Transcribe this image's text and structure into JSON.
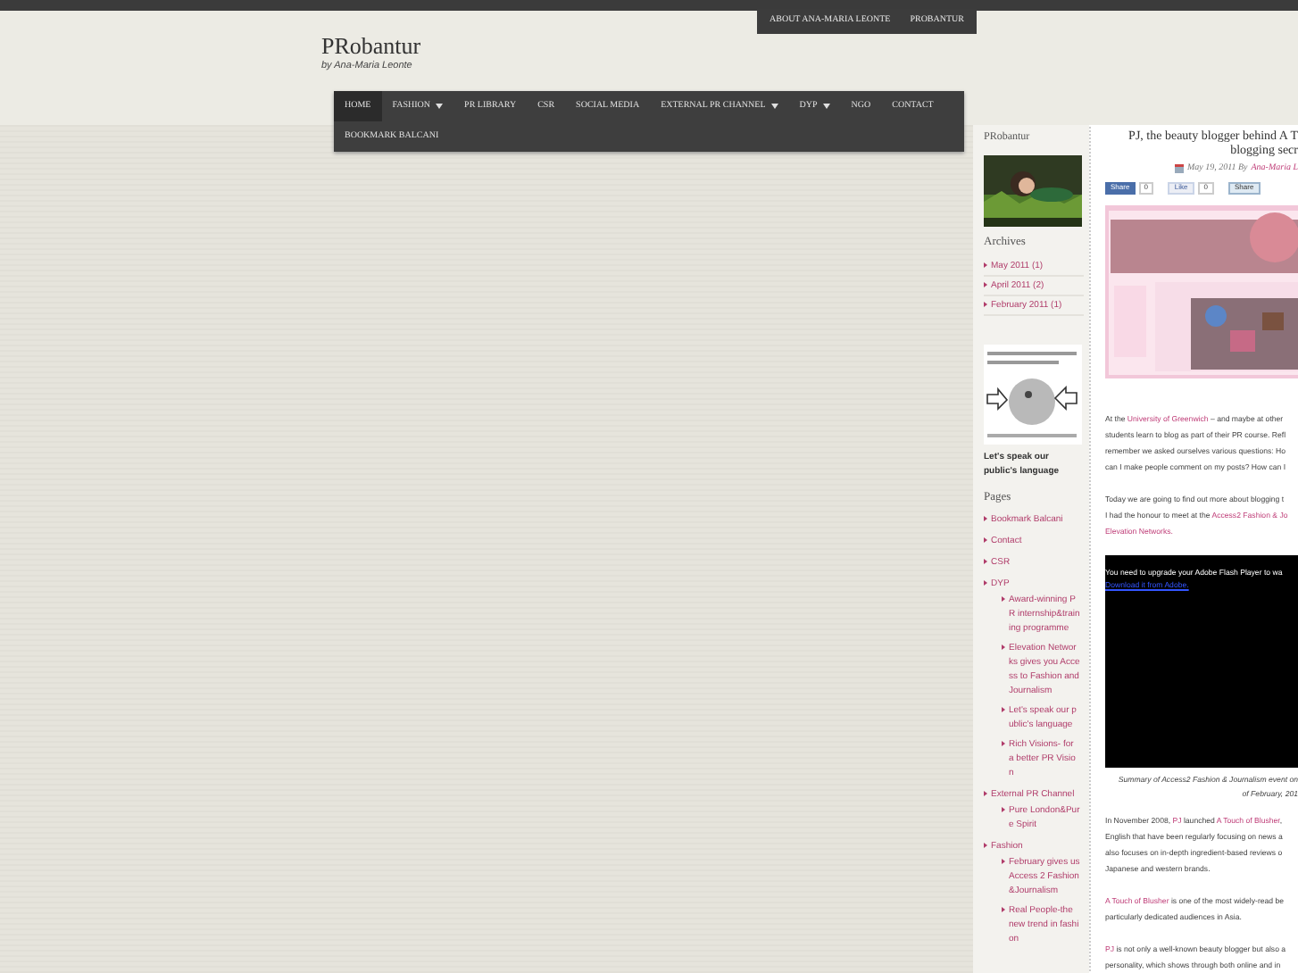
{
  "top_links": [
    {
      "label": "ABOUT ANA-MARIA LEONTE"
    },
    {
      "label": "PROBANTUR"
    }
  ],
  "site": {
    "title": "PRobantur",
    "tagline": "by Ana-Maria Leonte"
  },
  "nav": [
    {
      "label": "HOME",
      "selected": true,
      "dropdown": false
    },
    {
      "label": "FASHION",
      "selected": false,
      "dropdown": true
    },
    {
      "label": "PR LIBRARY",
      "selected": false,
      "dropdown": false
    },
    {
      "label": "CSR",
      "selected": false,
      "dropdown": false
    },
    {
      "label": "SOCIAL MEDIA",
      "selected": false,
      "dropdown": false
    },
    {
      "label": "EXTERNAL PR CHANNEL",
      "selected": false,
      "dropdown": true
    },
    {
      "label": "DYP",
      "selected": false,
      "dropdown": true
    },
    {
      "label": "NGO",
      "selected": false,
      "dropdown": false
    },
    {
      "label": "CONTACT",
      "selected": false,
      "dropdown": false
    },
    {
      "label": "BOOKMARK BALCANI",
      "selected": false,
      "dropdown": false
    }
  ],
  "sidebar": {
    "heading": "PRobantur",
    "archives_title": "Archives",
    "archives": [
      "May 2011 (1)",
      "April 2011 (2)",
      "February 2011 (1)"
    ],
    "image_caption": "Let's speak our public's language",
    "pages_title": "Pages",
    "pages": [
      {
        "label": "Bookmark Balcani"
      },
      {
        "label": "Contact"
      },
      {
        "label": "CSR"
      },
      {
        "label": "DYP",
        "children": [
          {
            "label": "Award-winning PR internship&training programme"
          },
          {
            "label": "Elevation Networks gives you Access to Fashion and Journalism"
          },
          {
            "label": "Let's speak our public's language"
          },
          {
            "label": "Rich Visions- for a better PR Vision"
          }
        ]
      },
      {
        "label": "External PR Channel",
        "children": [
          {
            "label": "Pure London&Pure Spirit"
          }
        ]
      },
      {
        "label": "Fashion",
        "children": [
          {
            "label": "February gives us Access 2 Fashion&Journalism"
          },
          {
            "label": "Real People-the new trend in fashion"
          }
        ]
      }
    ]
  },
  "post": {
    "title_lines": [
      "PJ, the beauty blogger behind A T",
      "blogging secr"
    ],
    "date": "May 19, 2011 By",
    "author": "Ana-Maria L",
    "share": [
      {
        "kind": "facebook",
        "label": "Share",
        "count": "0"
      },
      {
        "kind": "like",
        "label": "Like",
        "count": "0"
      },
      {
        "kind": "linkedin",
        "label": "Share"
      }
    ],
    "paragraphs_before": [
      [
        [
          {
            "t": "At the ",
            "link": false
          },
          {
            "t": "University of Greenwich",
            "link": true
          },
          {
            "t": " – and maybe at other",
            "link": false
          }
        ],
        [
          {
            "t": "students learn to blog as part of their PR course. Refl",
            "link": false
          }
        ],
        [
          {
            "t": "remember we asked ourselves various questions: Ho",
            "link": false
          }
        ],
        [
          {
            "t": "can I make people comment on my posts? How can I",
            "link": false
          }
        ]
      ],
      [
        [
          {
            "t": "Today we are going to find out more about blogging t",
            "link": false
          }
        ],
        [
          {
            "t": "I had the honour to meet at the ",
            "link": false
          },
          {
            "t": "Access2 Fashion & Jo",
            "link": true
          }
        ],
        [
          {
            "t": "Elevation Networks.",
            "link": true
          }
        ]
      ]
    ],
    "flash": {
      "message": "You need to upgrade your Adobe Flash Player to wa",
      "link": "Download it from Adobe."
    },
    "caption_lines": [
      "Summary of Access2 Fashion & Journalism event on",
      "of February, 201"
    ],
    "paragraphs_after": [
      [
        [
          {
            "t": "In November 2008, ",
            "link": false
          },
          {
            "t": "PJ",
            "link": true
          },
          {
            "t": " launched ",
            "link": false
          },
          {
            "t": "A Touch of Blusher",
            "link": true
          },
          {
            "t": ",",
            "link": false
          }
        ],
        [
          {
            "t": "English that have been regularly focusing on news a",
            "link": false
          }
        ],
        [
          {
            "t": "also focuses on in-depth ingredient-based reviews o",
            "link": false
          }
        ],
        [
          {
            "t": "Japanese and western brands.",
            "link": false
          }
        ]
      ],
      [
        [
          {
            "t": "A Touch of Blusher",
            "link": true
          },
          {
            "t": " is one of the most widely-read be",
            "link": false
          }
        ],
        [
          {
            "t": "particularly dedicated audiences in Asia.",
            "link": false
          }
        ]
      ],
      [
        [
          {
            "t": "PJ",
            "link": true
          },
          {
            "t": " is not only a well-known beauty blogger but also a",
            "link": false
          }
        ],
        [
          {
            "t": "personality, which shows through both online and in",
            "link": false
          }
        ]
      ]
    ]
  }
}
